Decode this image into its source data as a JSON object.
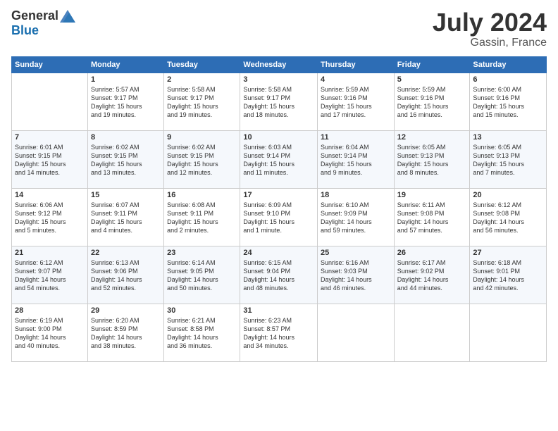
{
  "header": {
    "logo_general": "General",
    "logo_blue": "Blue",
    "title": "July 2024",
    "location": "Gassin, France"
  },
  "days_of_week": [
    "Sunday",
    "Monday",
    "Tuesday",
    "Wednesday",
    "Thursday",
    "Friday",
    "Saturday"
  ],
  "weeks": [
    [
      {
        "day": "",
        "content": ""
      },
      {
        "day": "1",
        "content": "Sunrise: 5:57 AM\nSunset: 9:17 PM\nDaylight: 15 hours\nand 19 minutes."
      },
      {
        "day": "2",
        "content": "Sunrise: 5:58 AM\nSunset: 9:17 PM\nDaylight: 15 hours\nand 19 minutes."
      },
      {
        "day": "3",
        "content": "Sunrise: 5:58 AM\nSunset: 9:17 PM\nDaylight: 15 hours\nand 18 minutes."
      },
      {
        "day": "4",
        "content": "Sunrise: 5:59 AM\nSunset: 9:16 PM\nDaylight: 15 hours\nand 17 minutes."
      },
      {
        "day": "5",
        "content": "Sunrise: 5:59 AM\nSunset: 9:16 PM\nDaylight: 15 hours\nand 16 minutes."
      },
      {
        "day": "6",
        "content": "Sunrise: 6:00 AM\nSunset: 9:16 PM\nDaylight: 15 hours\nand 15 minutes."
      }
    ],
    [
      {
        "day": "7",
        "content": "Sunrise: 6:01 AM\nSunset: 9:15 PM\nDaylight: 15 hours\nand 14 minutes."
      },
      {
        "day": "8",
        "content": "Sunrise: 6:02 AM\nSunset: 9:15 PM\nDaylight: 15 hours\nand 13 minutes."
      },
      {
        "day": "9",
        "content": "Sunrise: 6:02 AM\nSunset: 9:15 PM\nDaylight: 15 hours\nand 12 minutes."
      },
      {
        "day": "10",
        "content": "Sunrise: 6:03 AM\nSunset: 9:14 PM\nDaylight: 15 hours\nand 11 minutes."
      },
      {
        "day": "11",
        "content": "Sunrise: 6:04 AM\nSunset: 9:14 PM\nDaylight: 15 hours\nand 9 minutes."
      },
      {
        "day": "12",
        "content": "Sunrise: 6:05 AM\nSunset: 9:13 PM\nDaylight: 15 hours\nand 8 minutes."
      },
      {
        "day": "13",
        "content": "Sunrise: 6:05 AM\nSunset: 9:13 PM\nDaylight: 15 hours\nand 7 minutes."
      }
    ],
    [
      {
        "day": "14",
        "content": "Sunrise: 6:06 AM\nSunset: 9:12 PM\nDaylight: 15 hours\nand 5 minutes."
      },
      {
        "day": "15",
        "content": "Sunrise: 6:07 AM\nSunset: 9:11 PM\nDaylight: 15 hours\nand 4 minutes."
      },
      {
        "day": "16",
        "content": "Sunrise: 6:08 AM\nSunset: 9:11 PM\nDaylight: 15 hours\nand 2 minutes."
      },
      {
        "day": "17",
        "content": "Sunrise: 6:09 AM\nSunset: 9:10 PM\nDaylight: 15 hours\nand 1 minute."
      },
      {
        "day": "18",
        "content": "Sunrise: 6:10 AM\nSunset: 9:09 PM\nDaylight: 14 hours\nand 59 minutes."
      },
      {
        "day": "19",
        "content": "Sunrise: 6:11 AM\nSunset: 9:08 PM\nDaylight: 14 hours\nand 57 minutes."
      },
      {
        "day": "20",
        "content": "Sunrise: 6:12 AM\nSunset: 9:08 PM\nDaylight: 14 hours\nand 56 minutes."
      }
    ],
    [
      {
        "day": "21",
        "content": "Sunrise: 6:12 AM\nSunset: 9:07 PM\nDaylight: 14 hours\nand 54 minutes."
      },
      {
        "day": "22",
        "content": "Sunrise: 6:13 AM\nSunset: 9:06 PM\nDaylight: 14 hours\nand 52 minutes."
      },
      {
        "day": "23",
        "content": "Sunrise: 6:14 AM\nSunset: 9:05 PM\nDaylight: 14 hours\nand 50 minutes."
      },
      {
        "day": "24",
        "content": "Sunrise: 6:15 AM\nSunset: 9:04 PM\nDaylight: 14 hours\nand 48 minutes."
      },
      {
        "day": "25",
        "content": "Sunrise: 6:16 AM\nSunset: 9:03 PM\nDaylight: 14 hours\nand 46 minutes."
      },
      {
        "day": "26",
        "content": "Sunrise: 6:17 AM\nSunset: 9:02 PM\nDaylight: 14 hours\nand 44 minutes."
      },
      {
        "day": "27",
        "content": "Sunrise: 6:18 AM\nSunset: 9:01 PM\nDaylight: 14 hours\nand 42 minutes."
      }
    ],
    [
      {
        "day": "28",
        "content": "Sunrise: 6:19 AM\nSunset: 9:00 PM\nDaylight: 14 hours\nand 40 minutes."
      },
      {
        "day": "29",
        "content": "Sunrise: 6:20 AM\nSunset: 8:59 PM\nDaylight: 14 hours\nand 38 minutes."
      },
      {
        "day": "30",
        "content": "Sunrise: 6:21 AM\nSunset: 8:58 PM\nDaylight: 14 hours\nand 36 minutes."
      },
      {
        "day": "31",
        "content": "Sunrise: 6:23 AM\nSunset: 8:57 PM\nDaylight: 14 hours\nand 34 minutes."
      },
      {
        "day": "",
        "content": ""
      },
      {
        "day": "",
        "content": ""
      },
      {
        "day": "",
        "content": ""
      }
    ]
  ]
}
